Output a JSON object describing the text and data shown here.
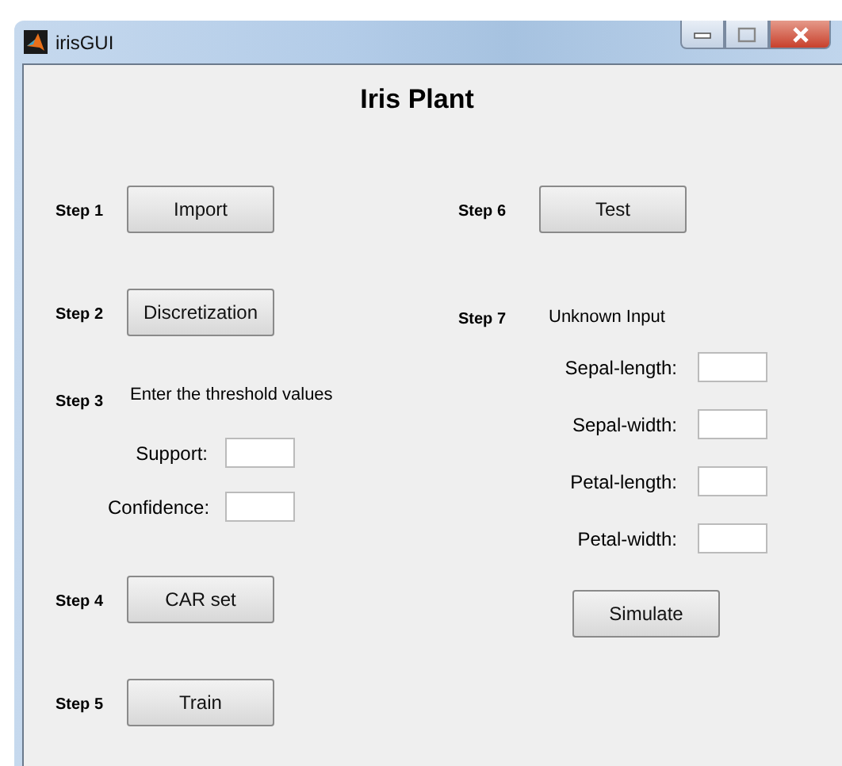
{
  "window": {
    "title": "irisGUI"
  },
  "heading": "Iris Plant",
  "left_steps": [
    {
      "kind": "button",
      "step": "Step 1",
      "label": "Import"
    },
    {
      "kind": "button",
      "step": "Step 2",
      "label": "Discretization"
    },
    {
      "kind": "text",
      "step": "Step 3",
      "label": "Enter the threshold values"
    },
    {
      "kind": "field",
      "label": "Support:"
    },
    {
      "kind": "field",
      "label": "Confidence:"
    },
    {
      "kind": "button",
      "step": "Step 4",
      "label": "CAR set"
    },
    {
      "kind": "button",
      "step": "Step 5",
      "label": "Train"
    }
  ],
  "right_steps": [
    {
      "kind": "button",
      "step": "Step 6",
      "label": "Test"
    },
    {
      "kind": "text",
      "step": "Step 7",
      "label": "Unknown Input"
    },
    {
      "kind": "field",
      "label": "Sepal-length:"
    },
    {
      "kind": "field",
      "label": "Sepal-width:"
    },
    {
      "kind": "field",
      "label": "Petal-length:"
    },
    {
      "kind": "field",
      "label": "Petal-width:"
    },
    {
      "kind": "button",
      "label": "Simulate"
    }
  ]
}
